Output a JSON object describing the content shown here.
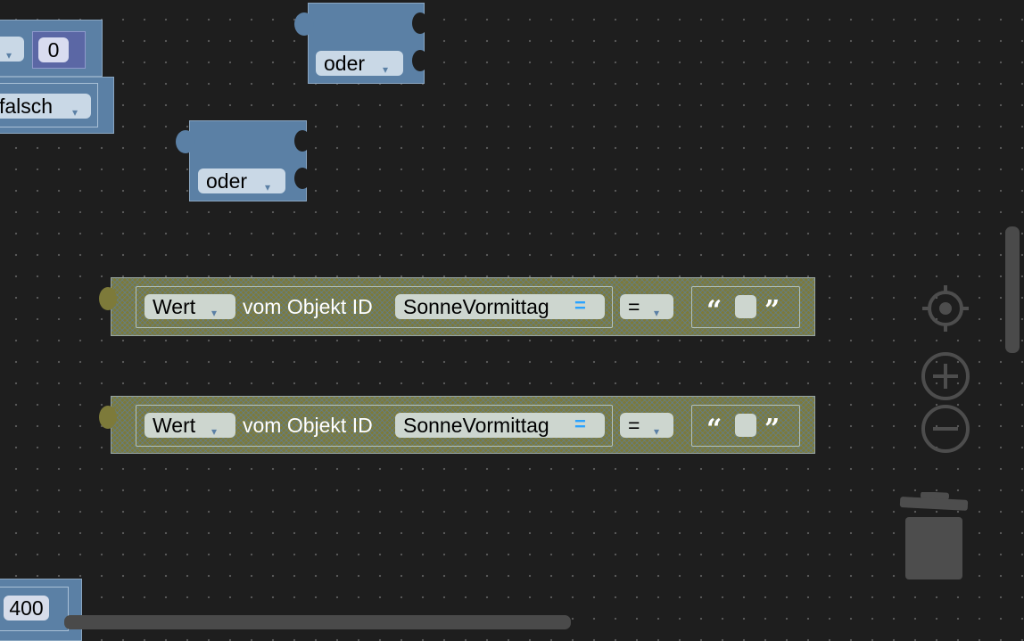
{
  "blocks": {
    "number_zero": "0",
    "falsch_dropdown": "falsch",
    "oder_top": "oder",
    "oder_mid": "oder",
    "number_400": "400"
  },
  "compare_blocks": [
    {
      "wert_dropdown": "Wert",
      "label": "vom Objekt ID",
      "object_id": "SonneVormittag",
      "equals_marker": "=",
      "operator": "="
    },
    {
      "wert_dropdown": "Wert",
      "label": "vom Objekt ID",
      "object_id": "SonneVormittag",
      "equals_marker": "=",
      "operator": "="
    }
  ],
  "icons": {
    "center": "crosshair-icon",
    "zoom_in": "zoom-in-icon",
    "zoom_out": "zoom-out-icon",
    "trash": "trash-icon",
    "dropdown": "▾",
    "quote_open": "“",
    "quote_close": "”"
  },
  "colors": {
    "workspace_bg": "#1e1e1e",
    "logic_block": "#5b80a5",
    "compare_block": "#7d7a3a",
    "number_block": "#5b67a5"
  }
}
